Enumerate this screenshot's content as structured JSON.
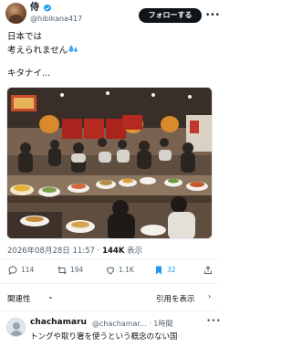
{
  "post": {
    "author": {
      "display_name": "侍",
      "handle": "@hibikana417",
      "verified_icon": "verified-badge-icon",
      "avatar_icon": "avatar-icon"
    },
    "follow_label": "フォローする",
    "more_icon": "more-icon",
    "text_lines": [
      "日本では",
      "考えられません",
      "",
      "キタナイ..."
    ],
    "emoji": "sweat-drops-icon",
    "media_icon": "restaurant-photo",
    "timestamp": "2026年08月28日 11:57 · ",
    "views_count": "144K",
    "views_label": " 表示"
  },
  "actions": {
    "reply_count": "114",
    "repost_count": "194",
    "like_count": "1.1K",
    "bookmark_count": "32",
    "icons": [
      "reply-icon",
      "repost-icon",
      "like-icon",
      "bookmark-icon",
      "share-icon"
    ]
  },
  "related": {
    "label": "関連性",
    "quotes_label": "引用を表示"
  },
  "reply": {
    "name": "chachamaru",
    "meta": "@chachamar... · 1時間",
    "text": "トングや取り箸を使うという概念のない国"
  },
  "colors": {
    "text_primary": "#0f1419",
    "text_secondary": "#536471",
    "verified": "#1d9bf0",
    "bookmark_active": "#1d9bf0",
    "follow_bg": "#0f1419"
  }
}
